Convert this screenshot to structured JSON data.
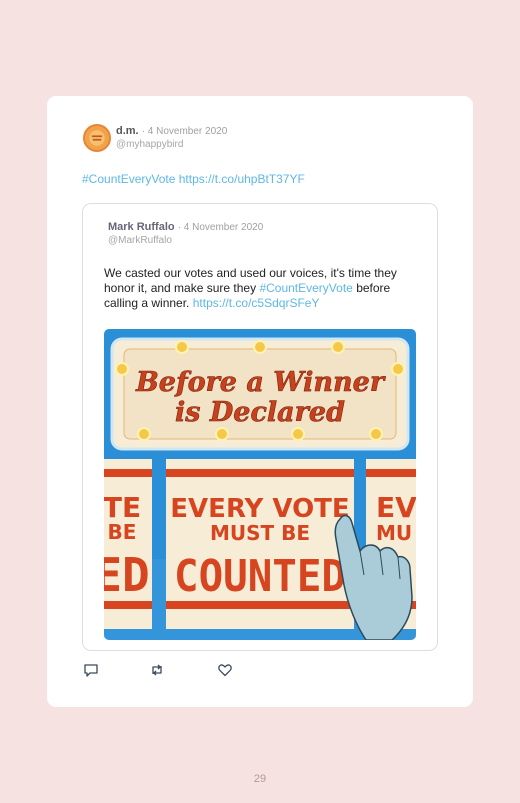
{
  "tweet": {
    "author_name": "d.m.",
    "date": "· 4 November 2020",
    "handle": "@myhappybird",
    "hashtag": "#CountEveryVote",
    "link": "https://t.co/uhpBtT37YF"
  },
  "quoted_tweet": {
    "author_name": "Mark Ruffalo",
    "date": "· 4 November 2020",
    "handle": "@MarkRuffalo",
    "text_part1": "We casted our votes and used our voices, it's time they honor it, and make sure they",
    "hashtag": "#CountEveryVote",
    "text_part2": "before calling a winner.",
    "link": "https://t.co/c5SdqrSFeY",
    "image": {
      "marquee_line1": "Before a Winner",
      "marquee_line2": "is Declared",
      "sign_line1": "EVERY VOTE",
      "sign_line2": "MUST BE",
      "sign_line3": "COUNTED",
      "left_sign_line1": "TE",
      "left_sign_line2": "BE",
      "left_sign_line3": "ED",
      "right_sign_line1": "EV",
      "right_sign_line2": "MU",
      "right_sign_line3": "C"
    }
  },
  "actions": {
    "reply_icon": "reply-icon",
    "retweet_icon": "retweet-icon",
    "like_icon": "heart-icon"
  },
  "page_number": "29",
  "colors": {
    "page_bg": "#f6e2e1",
    "link": "#5db8e6",
    "poster_blue": "#2a8fd6",
    "poster_red": "#d6451f",
    "poster_cream": "#f7ecd6"
  }
}
